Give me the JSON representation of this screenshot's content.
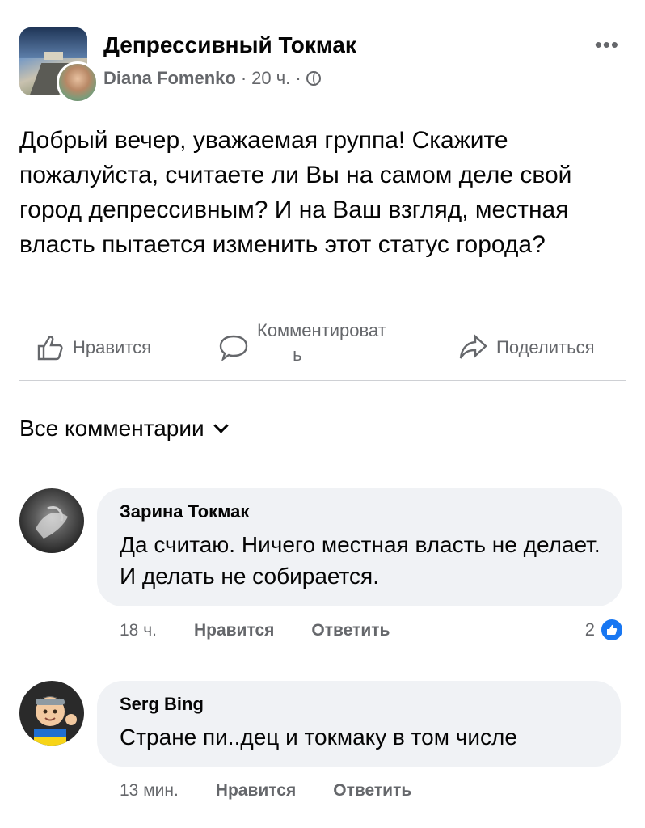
{
  "post": {
    "group_name": "Депрессивный Токмак",
    "author": "Diana Fomenko",
    "separator": "·",
    "time": "20 ч.",
    "more_label": "•••",
    "text": "Добрый вечер, уважаемая группа! Скажите пожалуйста, считаете ли Вы на самом деле свой город депрессивным? И на Ваш взгляд, местная власть пытается изменить этот статус города?"
  },
  "actions": {
    "like": "Нравится",
    "comment_line1": "Комментироват",
    "comment_line2": "ь",
    "share": "Поделиться"
  },
  "comments_filter": "Все комментарии",
  "comments": [
    {
      "name": "Зарина Токмак",
      "text": "Да считаю. Ничего местная власть не делает. И делать не собирается.",
      "time": "18 ч.",
      "like": "Нравится",
      "reply": "Ответить",
      "reaction_count": "2"
    },
    {
      "name": "Serg Bing",
      "text": "Стране пи..дец и токмаку в том числе",
      "time": "13 мин.",
      "like": "Нравится",
      "reply": "Ответить"
    }
  ],
  "colors": {
    "accent": "#1877f2",
    "secondary_text": "#65676b",
    "bubble": "#f0f2f5"
  },
  "icons": [
    "globe-icon",
    "more-icon",
    "like-icon",
    "comment-icon",
    "share-icon",
    "chevron-down-icon",
    "like-reaction-icon"
  ]
}
